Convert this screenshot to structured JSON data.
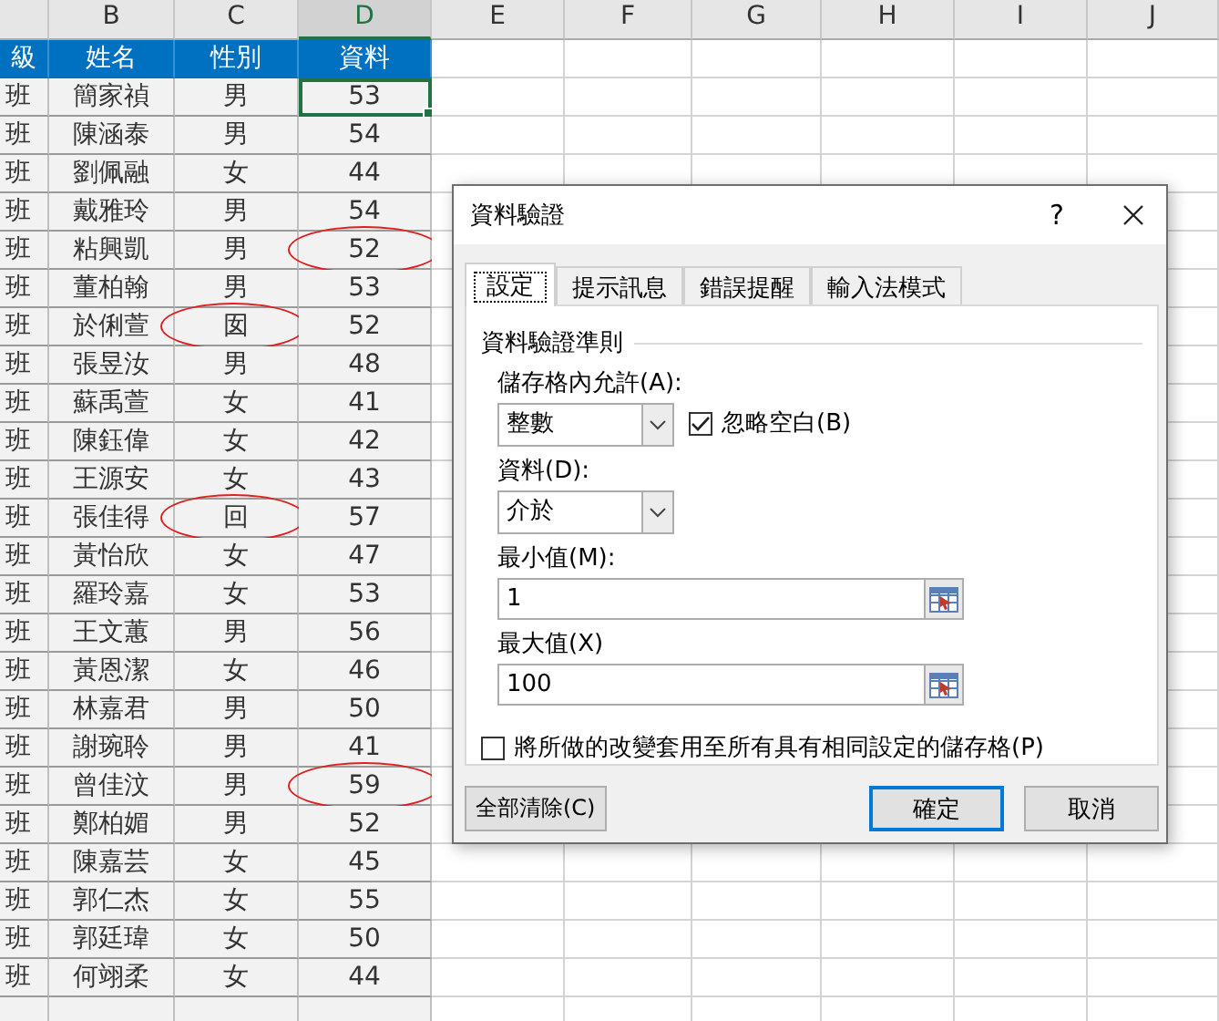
{
  "spreadsheet": {
    "column_headers": [
      {
        "selected": false
      },
      {
        "label": "B",
        "selected": false
      },
      {
        "label": "C",
        "selected": false
      },
      {
        "label": "D",
        "selected": true
      },
      {
        "label": "E",
        "selected": false
      },
      {
        "label": "F",
        "selected": false
      },
      {
        "label": "G",
        "selected": false
      },
      {
        "label": "H",
        "selected": false
      },
      {
        "label": "I",
        "selected": false
      },
      {
        "label": "J",
        "selected": false
      }
    ],
    "header_row": [
      "級",
      "姓名",
      "性別",
      "資料"
    ],
    "rows": [
      {
        "class": "班",
        "name": "簡家禎",
        "gender": "男",
        "value": "53",
        "selected": true,
        "gender_circled": false,
        "value_circled": false
      },
      {
        "class": "班",
        "name": "陳涵泰",
        "gender": "男",
        "value": "54",
        "selected": false,
        "gender_circled": false,
        "value_circled": false
      },
      {
        "class": "班",
        "name": "劉佩融",
        "gender": "女",
        "value": "44",
        "selected": false,
        "gender_circled": false,
        "value_circled": false
      },
      {
        "class": "班",
        "name": "戴雅玲",
        "gender": "男",
        "value": "54",
        "selected": false,
        "gender_circled": false,
        "value_circled": false
      },
      {
        "class": "班",
        "name": "粘興凱",
        "gender": "男",
        "value": "52",
        "selected": false,
        "gender_circled": false,
        "value_circled": true
      },
      {
        "class": "班",
        "name": "董柏翰",
        "gender": "男",
        "value": "53",
        "selected": false,
        "gender_circled": false,
        "value_circled": false
      },
      {
        "class": "班",
        "name": "於俐萱",
        "gender": "囡",
        "value": "52",
        "selected": false,
        "gender_circled": true,
        "value_circled": false
      },
      {
        "class": "班",
        "name": "張昱汝",
        "gender": "男",
        "value": "48",
        "selected": false,
        "gender_circled": false,
        "value_circled": false
      },
      {
        "class": "班",
        "name": "蘇禹萱",
        "gender": "女",
        "value": "41",
        "selected": false,
        "gender_circled": false,
        "value_circled": false
      },
      {
        "class": "班",
        "name": "陳鈺偉",
        "gender": "女",
        "value": "42",
        "selected": false,
        "gender_circled": false,
        "value_circled": false
      },
      {
        "class": "班",
        "name": "王源安",
        "gender": "女",
        "value": "43",
        "selected": false,
        "gender_circled": false,
        "value_circled": false
      },
      {
        "class": "班",
        "name": "張佳得",
        "gender": "回",
        "value": "57",
        "selected": false,
        "gender_circled": true,
        "value_circled": false
      },
      {
        "class": "班",
        "name": "黃怡欣",
        "gender": "女",
        "value": "47",
        "selected": false,
        "gender_circled": false,
        "value_circled": false
      },
      {
        "class": "班",
        "name": "羅玲嘉",
        "gender": "女",
        "value": "53",
        "selected": false,
        "gender_circled": false,
        "value_circled": false
      },
      {
        "class": "班",
        "name": "王文蕙",
        "gender": "男",
        "value": "56",
        "selected": false,
        "gender_circled": false,
        "value_circled": false
      },
      {
        "class": "班",
        "name": "黃恩潔",
        "gender": "女",
        "value": "46",
        "selected": false,
        "gender_circled": false,
        "value_circled": false
      },
      {
        "class": "班",
        "name": "林嘉君",
        "gender": "男",
        "value": "50",
        "selected": false,
        "gender_circled": false,
        "value_circled": false
      },
      {
        "class": "班",
        "name": "謝琬聆",
        "gender": "男",
        "value": "41",
        "selected": false,
        "gender_circled": false,
        "value_circled": false
      },
      {
        "class": "班",
        "name": "曾佳汶",
        "gender": "男",
        "value": "59",
        "selected": false,
        "gender_circled": false,
        "value_circled": true
      },
      {
        "class": "班",
        "name": "鄭柏媚",
        "gender": "男",
        "value": "52",
        "selected": false,
        "gender_circled": false,
        "value_circled": false
      },
      {
        "class": "班",
        "name": "陳嘉芸",
        "gender": "女",
        "value": "45",
        "selected": false,
        "gender_circled": false,
        "value_circled": false
      },
      {
        "class": "班",
        "name": "郭仁杰",
        "gender": "女",
        "value": "55",
        "selected": false,
        "gender_circled": false,
        "value_circled": false
      },
      {
        "class": "班",
        "name": "郭廷瑋",
        "gender": "女",
        "value": "50",
        "selected": false,
        "gender_circled": false,
        "value_circled": false
      },
      {
        "class": "班",
        "name": "何翊柔",
        "gender": "女",
        "value": "44",
        "selected": false,
        "gender_circled": false,
        "value_circled": false
      }
    ]
  },
  "dialog": {
    "title": "資料驗證",
    "help": "?",
    "tabs": [
      {
        "label": "設定",
        "selected": true
      },
      {
        "label": "提示訊息",
        "selected": false
      },
      {
        "label": "錯誤提醒",
        "selected": false
      },
      {
        "label": "輸入法模式",
        "selected": false
      }
    ],
    "group_title": "資料驗證準則",
    "allow_label": "儲存格內允許(A):",
    "allow_value": "整數",
    "ignore_blank": {
      "label": "忽略空白(B)",
      "checked": true
    },
    "data_label": "資料(D):",
    "data_value": "介於",
    "min_label": "最小值(M):",
    "min_value": "1",
    "max_label": "最大值(X)",
    "max_value": "100",
    "apply_all": {
      "label": "將所做的改變套用至所有具有相同設定的儲存格(P)",
      "checked": false
    },
    "buttons": [
      {
        "label": "全部清除(C)",
        "kind": "clear"
      },
      {
        "label": "確定",
        "kind": "default"
      },
      {
        "label": "取消",
        "kind": "normal"
      }
    ]
  }
}
